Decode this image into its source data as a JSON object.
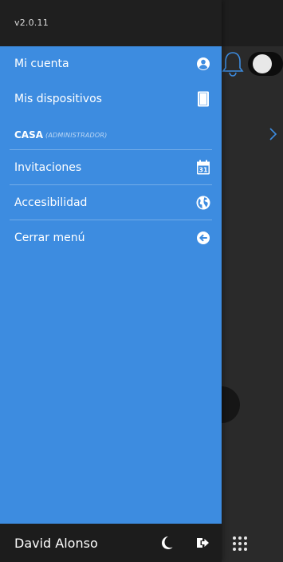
{
  "app": {
    "version": "v2.0.11"
  },
  "menu": {
    "items": [
      {
        "label": "Mi cuenta",
        "icon": "user-circle-icon"
      },
      {
        "label": "Mis dispositivos",
        "icon": "tablet-icon"
      },
      {
        "label": "Invitaciones",
        "icon": "calendar-icon",
        "icon_text": "31"
      },
      {
        "label": "Accesibilidad",
        "icon": "globe-icon"
      },
      {
        "label": "Cerrar menú",
        "icon": "arrow-left-circle-icon"
      }
    ],
    "home": {
      "name": "CASA",
      "role": "(ADMINISTRADOR)"
    }
  },
  "footer": {
    "user_name": "David Alonso",
    "icons": [
      "moon-icon",
      "logout-icon"
    ]
  },
  "background": {
    "icons": [
      "bell-icon",
      "toggle-switch",
      "chevron-right-icon",
      "grid-dots-icon"
    ]
  },
  "colors": {
    "drawer": "#3d8ce0",
    "header": "#1f1f1f",
    "footer": "#1c1c1c",
    "background": "#2a2a2a",
    "accent_bell": "#3d8ce0"
  }
}
